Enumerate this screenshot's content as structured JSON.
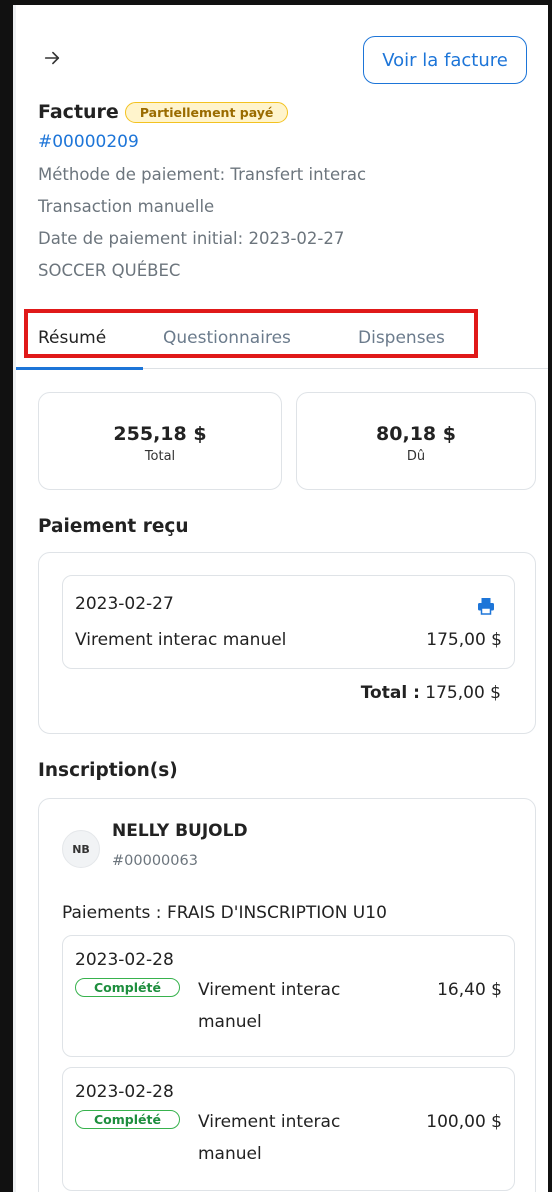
{
  "header": {
    "voir_facture_label": "Voir la facture"
  },
  "invoice": {
    "title": "Facture",
    "status": "Partiellement payé",
    "number": "#00000209",
    "payment_method": "Méthode de paiement: Transfert interac",
    "transaction": "Transaction manuelle",
    "initial_date": "Date de paiement initial: 2023-02-27",
    "organization": "SOCCER QUÉBEC"
  },
  "tabs": [
    {
      "label": "Résumé",
      "active": true
    },
    {
      "label": "Questionnaires",
      "active": false
    },
    {
      "label": "Dispenses",
      "active": false
    }
  ],
  "stats": {
    "total_value": "255,18 $",
    "total_label": "Total",
    "due_value": "80,18 $",
    "due_label": "Dû"
  },
  "payment_received": {
    "section_title": "Paiement reçu",
    "date": "2023-02-27",
    "method": "Virement interac manuel",
    "amount": "175,00 $",
    "total_label": "Total :",
    "total_value": "175,00 $"
  },
  "registrations": {
    "section_title": "Inscription(s)",
    "member": {
      "initials": "NB",
      "name": "NELLY BUJOLD",
      "number": "#00000063"
    },
    "payments_title": "Paiements : FRAIS D'INSCRIPTION U10",
    "payments": [
      {
        "date": "2023-02-28",
        "status": "Complété",
        "method_line1": "Virement interac",
        "method_line2": "manuel",
        "amount": "16,40 $"
      },
      {
        "date": "2023-02-28",
        "status": "Complété",
        "method_line1": "Virement interac",
        "method_line2": "manuel",
        "amount": "100,00 $"
      }
    ]
  },
  "colors": {
    "accent": "#1d75d8",
    "partial_badge": "#f3c220",
    "complete_badge": "#37b24d",
    "highlight": "#e01919"
  }
}
